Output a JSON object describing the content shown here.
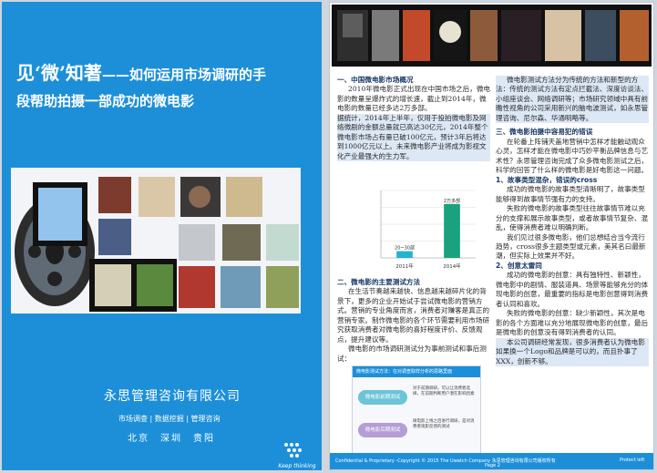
{
  "page1": {
    "title_highlight": "见‘微’知著",
    "title_rest": "——如何运用市场调研的手",
    "title_line2": "段帮助拍摄一部成功的微电影",
    "company": "永思管理咨询有限公司",
    "services": "市场调查 | 数据挖掘 | 管理咨询",
    "cities": "北京　深圳　贵阳",
    "logo_text": "Keep thinking"
  },
  "page2": {
    "sections": {
      "s1_heading": "一、中国微电影市场概况",
      "s1_body_a": "2010年微电影正式出现在中国市场之后，微电影的数量呈爆炸式的增长速，截止到2014年，微电影的数量已经多达2万多部。",
      "s1_body_b": "据统计，2014年上半年，仅用于投拍微电影及网络微剧的金额总量就已高达30亿元，2014年整个微电影市场占有量已破100亿元，预计3年后将达到1000亿元以上。未来微电影产业将成为影视文化产业最强大的生力军。",
      "s2_heading": "二、微电影的主要测试方法",
      "s2_body_a": "在生活节奏越来越快、信息越来越碎片化的背景下，更多的企业开始试于尝试微电影的营销方式。营销的专业角度而言，消费者对赚客是真正的营销专家。制作微电影的各个环节需要利用市场研究获取消费者对微电影的喜好程度评价、反馈观点，提升建议等。",
      "s2_body_b": "微电影的市场调研测试分为事前测试和事后测试：",
      "s2_col2": "微电影测试方法分为传统的方法和新型的方法：传统的测试方法有定点拦截法、深度访谈法、小组座谈会、网络调研等；市场研究领域中具有前瞻性视角的公司采用新兴的脑电波测试，如永思管理咨询、尼尔森、华通明略等。",
      "s3_heading": "三、微电影拍摄中容易犯的错误",
      "s3_body": "在轮番上阵铺天盖地营销中怎样才能触动观众心灵，怎样才能在微电影中巧妙平衡品牌信息与艺术性？永思管理咨询完成了众多微电影测试之后，科学的回答了什么样的微电影是好电影这一问题。",
      "s3_p1": "1、故事类型混杂，错误的cross",
      "s3_p1_a": "成功的微电影的故事类型清晰明了，故事类型能够得到故事情节强有力的支持。",
      "s3_p1_b": "失败的微电影的故事类型往往故事情节难以充分的支撑和展示故事类型，或者故事情节复杂、混乱，使得消费者难以明确判断。",
      "s3_p1_c": "我们见过很多微电影，他们总想结合当今流行趋势，cross很多主题类型或元素，美其名曰最新潮，但实际上效果并不好。",
      "s3_p2": "2、创意太雷同",
      "s3_p2_a": "成功的微电影的创意：具有独特性、新颖性，微电影中的剧情、服装道具、场景等能够充分的体现电影的创意，最重要的指标是电影创意得到消费者认同和喜欢。",
      "s3_p2_b": "失败的微电影的创意：缺少新颖性，其次是电影的各个方面难以充分地展现微电影的创意，最后是微电影的创意没有得到消费者的认同。",
      "s3_close": "本公司调研经常发现，很多消费者认为微电影如果换一个Logo和品牌是可以的，而且扑事了XXX，创新不够。"
    },
    "footer_left": "Confidential & Proprietary -Copyright © 2015 The Uwatch Company 永思管理咨询有限公司版权所有",
    "footer_page": "Page 2",
    "footer_right": "Protect left"
  },
  "chart_data": {
    "type": "bar",
    "categories": [
      "2011年",
      "2014年"
    ],
    "values": [
      0.25,
      2
    ],
    "data_labels": [
      "20~30部",
      "2万多部"
    ],
    "ylim": [
      0,
      2.5
    ],
    "yticks": [
      "",
      "",
      "",
      "",
      ""
    ],
    "xlabel": "",
    "ylabel": "",
    "grid": true,
    "colors": [
      "#23b3d0",
      "#1aa17e"
    ]
  },
  "diagram": {
    "title": "微电影测试方法：在对调查取样分析的思路里面",
    "left_header": "微电影测试方法",
    "right_header": "",
    "boxes": [
      "微电影前期测试",
      "微电影后期测试"
    ],
    "box_notes": [
      "对于前期调研，可以让消费者选择，在前期判断用户潜在影响因素",
      "微电影上线之后进行调研，是对消费者观影反馈的测试"
    ]
  }
}
